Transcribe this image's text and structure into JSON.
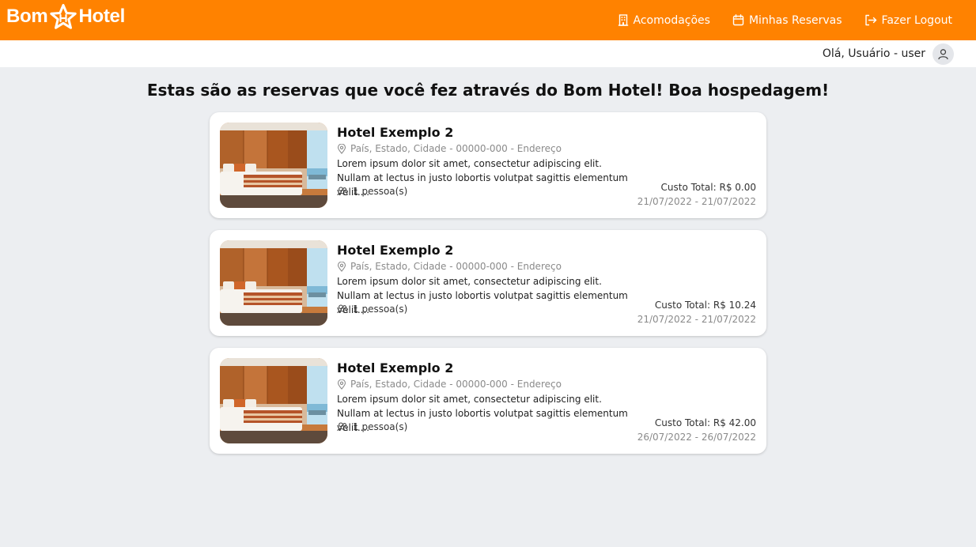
{
  "brand": {
    "word1": "Bom",
    "word2": "Hotel",
    "color": "#ff8200"
  },
  "nav": {
    "items": [
      {
        "label": "Acomodações",
        "icon": "building-icon"
      },
      {
        "label": "Minhas Reservas",
        "icon": "calendar-icon"
      },
      {
        "label": "Fazer Logout",
        "icon": "logout-icon"
      }
    ]
  },
  "user": {
    "greeting": "Olá, Usuário - user",
    "icon": "user-icon"
  },
  "page": {
    "title": "Estas são as reservas que você fez através do Bom Hotel! Boa hospedagem!"
  },
  "reservations": [
    {
      "name": "Hotel Exemplo 2",
      "address": "País, Estado, Cidade - 00000-000 - Endereço",
      "description": "Lorem ipsum dolor sit amet, consectetur adipiscing elit. Nullam at lectus in justo lobortis volutpat sagittis elementum velit....",
      "guests": "1 pessoa(s)",
      "cost": "Custo Total: R$ 0.00",
      "dates": "21/07/2022 - 21/07/2022"
    },
    {
      "name": "Hotel Exemplo 2",
      "address": "País, Estado, Cidade - 00000-000 - Endereço",
      "description": "Lorem ipsum dolor sit amet, consectetur adipiscing elit. Nullam at lectus in justo lobortis volutpat sagittis elementum velit....",
      "guests": "1 pessoa(s)",
      "cost": "Custo Total: R$ 10.24",
      "dates": "21/07/2022 - 21/07/2022"
    },
    {
      "name": "Hotel Exemplo 2",
      "address": "País, Estado, Cidade - 00000-000 - Endereço",
      "description": "Lorem ipsum dolor sit amet, consectetur adipiscing elit. Nullam at lectus in justo lobortis volutpat sagittis elementum velit....",
      "guests": "1 pessoa(s)",
      "cost": "Custo Total: R$ 42.00",
      "dates": "26/07/2022 - 26/07/2022"
    }
  ]
}
